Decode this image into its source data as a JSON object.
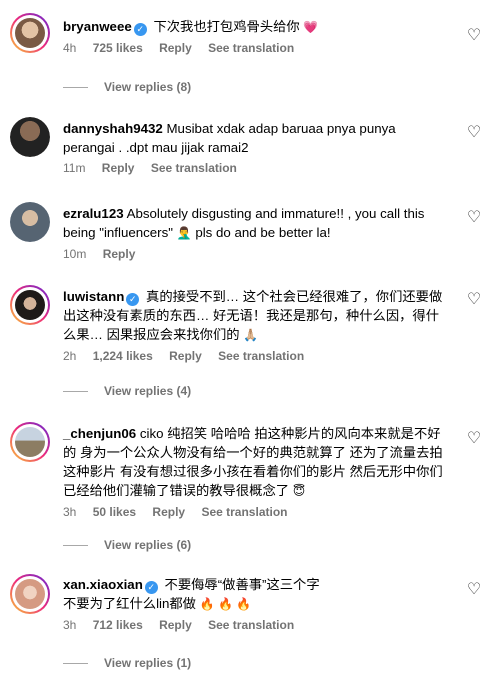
{
  "comments": [
    {
      "username": "bryanweee",
      "verified": true,
      "text": "下次我也打包鸡骨头给你",
      "emoji": "💗",
      "time": "4h",
      "likes": "725 likes",
      "reply": "Reply",
      "translation": "See translation",
      "view_replies": "View replies (8)",
      "avatar_color": "#c9a889"
    },
    {
      "username": "dannyshah9432",
      "verified": false,
      "text": "Musibat xdak adap baruaa pnya punya perangai . .dpt mau jijak ramai2",
      "time": "11m",
      "reply": "Reply",
      "translation": "See translation",
      "avatar_color": "#4a3b32"
    },
    {
      "username": "ezralu123",
      "verified": false,
      "text_before": "Absolutely disgusting and immature!! , you call this being \"influencers\" ",
      "emoji": "🤦‍♂️",
      "text_after": " pls do and be better la!",
      "time": "10m",
      "reply": "Reply",
      "avatar_color": "#6b7a8f"
    },
    {
      "username": "luwistann",
      "verified": true,
      "text": "真的接受不到… 这个社会已经很难了，你们还要做出这种没有素质的东西… 好无语！我还是那句，种什么因，得什么果… 因果报应会来找你们的",
      "emoji": "🙏🏼",
      "time": "2h",
      "likes": "1,224 likes",
      "reply": "Reply",
      "translation": "See translation",
      "view_replies": "View replies (4)",
      "avatar_color": "#2f2a28"
    },
    {
      "username": "_chenjun06",
      "verified": false,
      "text": "ciko 纯招笑 哈哈哈 拍这种影片的风向本来就是不好的 身为一个公众人物没有给一个好的典范就算了 还为了流量去拍这种影片 有没有想过很多小孩在看着你们的影片 然后无形中你们已经给他们灌输了错误的教导很概念了",
      "emoji": "😇",
      "time": "3h",
      "likes": "50 likes",
      "reply": "Reply",
      "translation": "See translation",
      "view_replies": "View replies (6)",
      "avatar_color": "#9a8f7c"
    },
    {
      "username": "xan.xiaoxian",
      "verified": true,
      "text": "不要侮辱“做善事”这三个字",
      "text2": "不要为了红什么lin都做",
      "emoji": "🔥 🔥 🔥",
      "time": "3h",
      "likes": "712 likes",
      "reply": "Reply",
      "translation": "See translation",
      "view_replies": "View replies (1)",
      "avatar_color": "#e6b7a0"
    }
  ],
  "icons": {
    "like": "heart-outline-icon",
    "verified": "verified-badge-icon"
  },
  "colors": {
    "verified": "#3897f0",
    "muted": "#737373"
  }
}
